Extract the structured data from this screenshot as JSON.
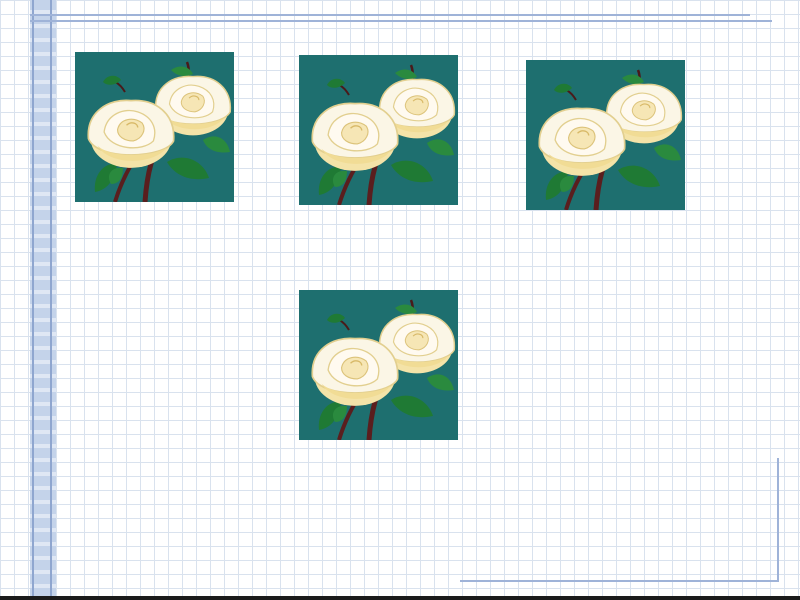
{
  "slide": {
    "background": "#ffffff",
    "grid_color": "#d9e2ee",
    "accent_color": "#9fb3d8"
  },
  "images": [
    {
      "name": "white-roses-image",
      "icon": "white-roses",
      "fill": "#1e6f6f"
    },
    {
      "name": "white-roses-image",
      "icon": "white-roses",
      "fill": "#1e6f6f"
    },
    {
      "name": "white-roses-image",
      "icon": "white-roses",
      "fill": "#1e6f6f"
    },
    {
      "name": "white-roses-image",
      "icon": "white-roses",
      "fill": "#1e6f6f"
    }
  ]
}
